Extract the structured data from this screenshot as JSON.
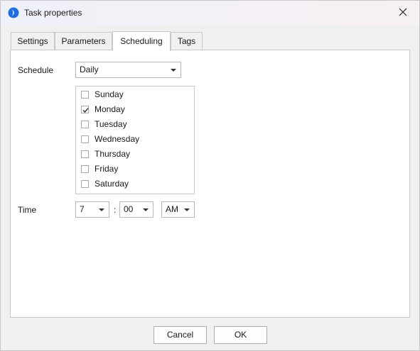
{
  "window": {
    "title": "Task properties"
  },
  "tabs": [
    {
      "label": "Settings"
    },
    {
      "label": "Parameters"
    },
    {
      "label": "Scheduling"
    },
    {
      "label": "Tags"
    }
  ],
  "active_tab": "Scheduling",
  "schedule": {
    "label": "Schedule",
    "value": "Daily",
    "days": [
      {
        "label": "Sunday",
        "checked": false
      },
      {
        "label": "Monday",
        "checked": true
      },
      {
        "label": "Tuesday",
        "checked": false
      },
      {
        "label": "Wednesday",
        "checked": false
      },
      {
        "label": "Thursday",
        "checked": false
      },
      {
        "label": "Friday",
        "checked": false
      },
      {
        "label": "Saturday",
        "checked": false
      }
    ]
  },
  "time": {
    "label": "Time",
    "hour": "7",
    "separator": ":",
    "minute": "00",
    "ampm": "AM"
  },
  "buttons": {
    "cancel": "Cancel",
    "ok": "OK"
  },
  "colors": {
    "app_icon": "#1a73e8",
    "accent": "#1a73e8"
  }
}
